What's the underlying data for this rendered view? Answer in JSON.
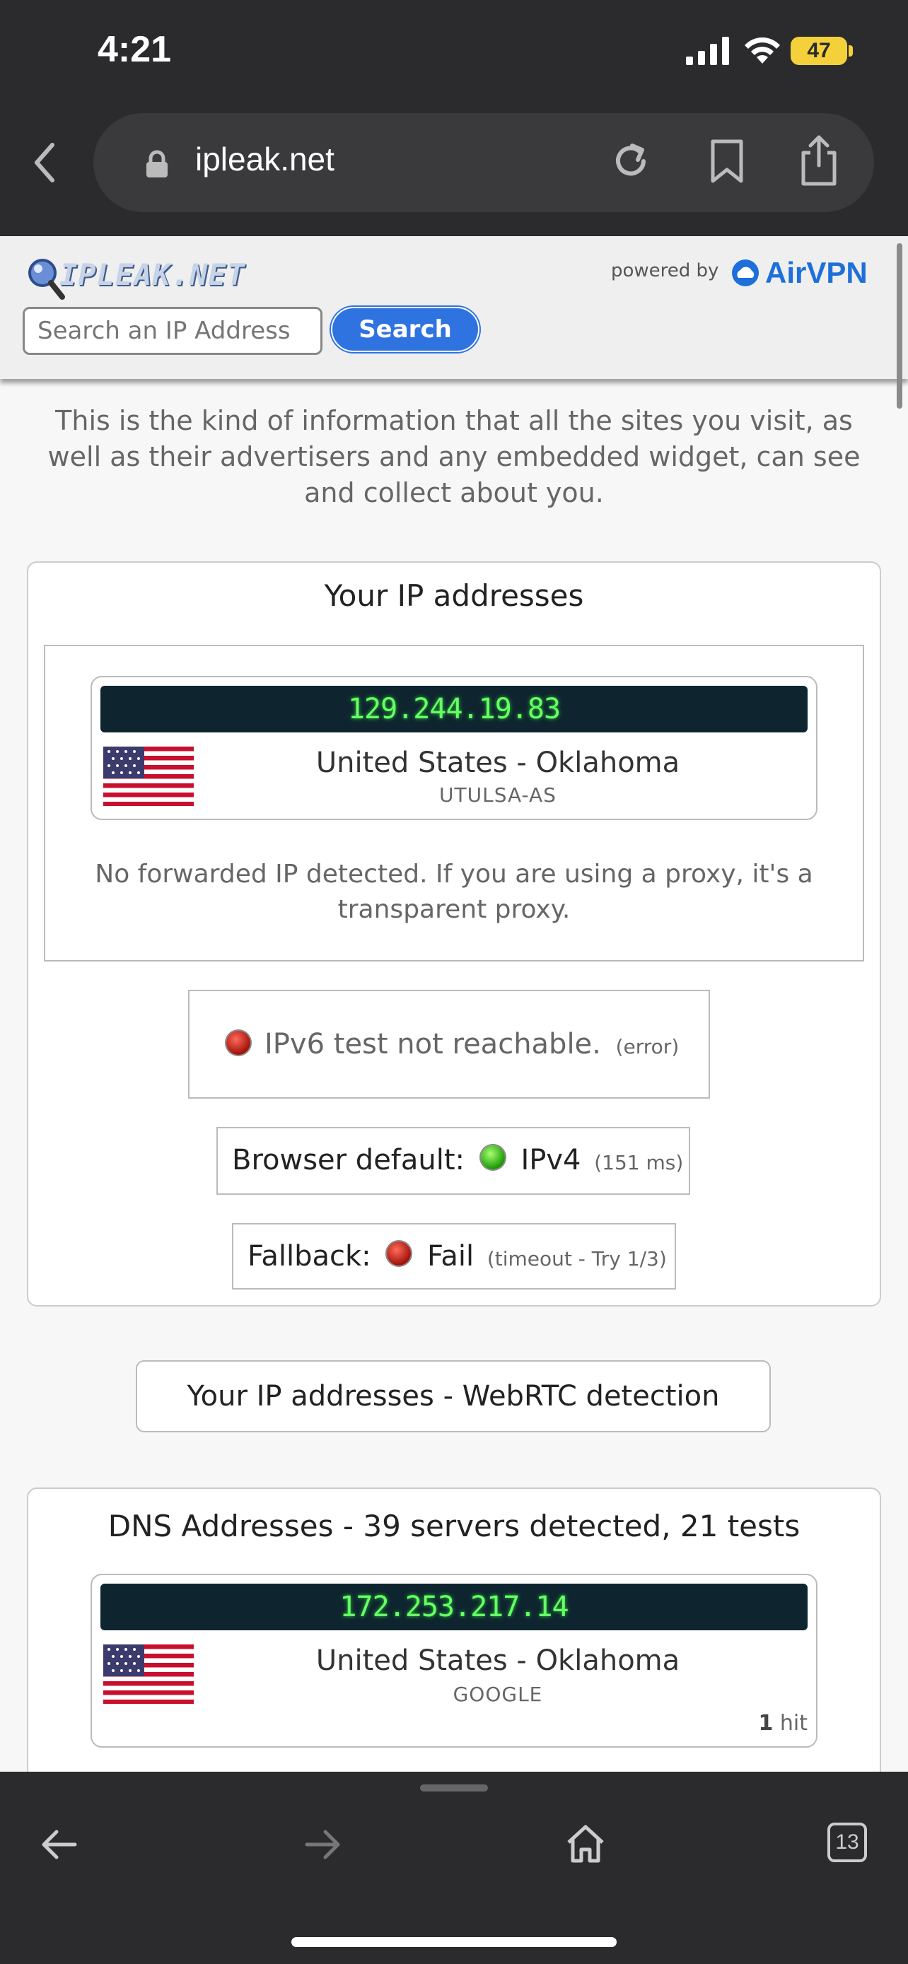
{
  "status_bar": {
    "time": "4:21",
    "battery": "47",
    "signal_icon": "cellular-signal-icon",
    "wifi_icon": "wifi-icon"
  },
  "browser": {
    "url": "ipleak.net",
    "lock_icon": "lock-icon",
    "reload_icon": "reload-icon",
    "bookmark_icon": "bookmark-icon",
    "share_icon": "share-icon",
    "back_icon": "chevron-left-icon"
  },
  "site_header": {
    "logo_text": "IPLEAK.NET",
    "powered_by": "powered by",
    "brand": "AirVPN",
    "search_placeholder": "Search an IP Address",
    "search_button": "Search"
  },
  "intro": "This is the kind of information that all the sites you visit, as well as their advertisers and any embedded widget, can see and collect about you.",
  "ip_section": {
    "title": "Your IP addresses",
    "ip": "129.244.19.83",
    "location": "United States - Oklahoma",
    "isp": "UTULSA-AS",
    "forwarded_note": "No forwarded IP detected. If you are using a proxy, it's a transparent proxy.",
    "ipv6_status": "IPv6 test not reachable.",
    "ipv6_detail": "(error)",
    "browser_default_label": "Browser default:",
    "browser_default_value": "IPv4",
    "browser_default_detail": "(151 ms)",
    "fallback_label": "Fallback:",
    "fallback_value": "Fail",
    "fallback_detail": "(timeout - Try 1/3)",
    "status_colors": {
      "error": "#c0190c",
      "ok": "#2ec40f"
    }
  },
  "webrtc_button": "Your IP addresses - WebRTC detection",
  "dns_section": {
    "title": "DNS Addresses - 39 servers detected, 21 tests",
    "ip": "172.253.217.14",
    "location": "United States - Oklahoma",
    "isp": "GOOGLE",
    "hits_count": "1",
    "hits_label": "hit"
  },
  "toolbar": {
    "back_icon": "arrow-left-icon",
    "forward_icon": "arrow-right-icon",
    "home_icon": "home-icon",
    "tabs_count": "13"
  }
}
